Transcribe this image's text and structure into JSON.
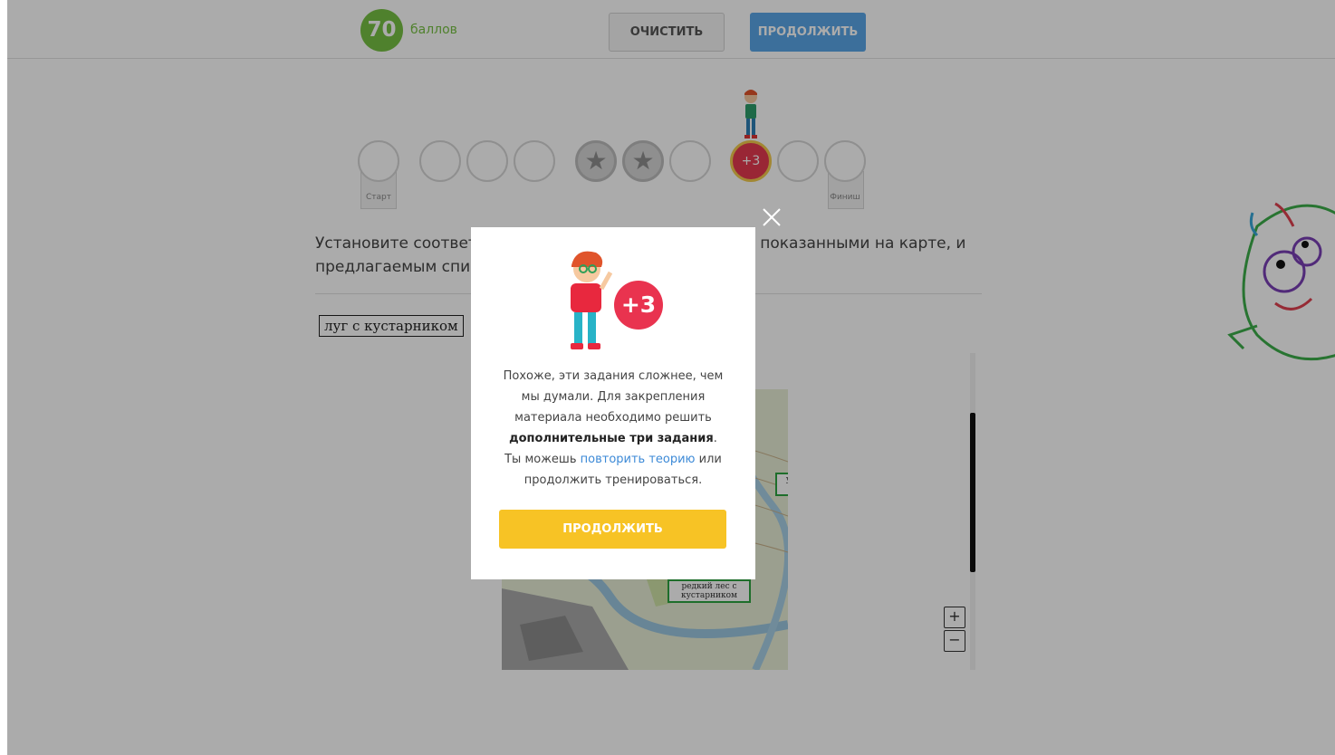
{
  "header": {
    "score_value": "70",
    "score_label": "баллов",
    "clear_label": "ОЧИСТИТЬ",
    "continue_label": "ПРОДОЛЖИТЬ"
  },
  "progress": {
    "start_label": "Старт",
    "finish_label": "Финиш",
    "current_step_label": "+3"
  },
  "task": {
    "text": "Установите соответствие между условными знаками, показанными на карте, и предлагаемым списком.",
    "term": "луг с кустарником",
    "map_labels": [
      "узкая полоска леса",
      "редкий лес с кустарником"
    ],
    "zoom_in": "+",
    "zoom_out": "−"
  },
  "modal": {
    "badge": "+3",
    "text_1": "Похоже, эти задания сложнее, чем мы думали. Для закрепления материала необходимо решить",
    "text_bold": "дополнительные три задания",
    "text_2": ".",
    "text_3": "Ты можешь",
    "link": "повторить теорию",
    "text_4": "или продолжить тренироваться.",
    "button": "ПРОДОЛЖИТЬ"
  },
  "colors": {
    "score_green": "#77c043",
    "primary_blue": "#5aa6e8",
    "accent_yellow": "#f7c325",
    "badge_red": "#e9334f"
  }
}
